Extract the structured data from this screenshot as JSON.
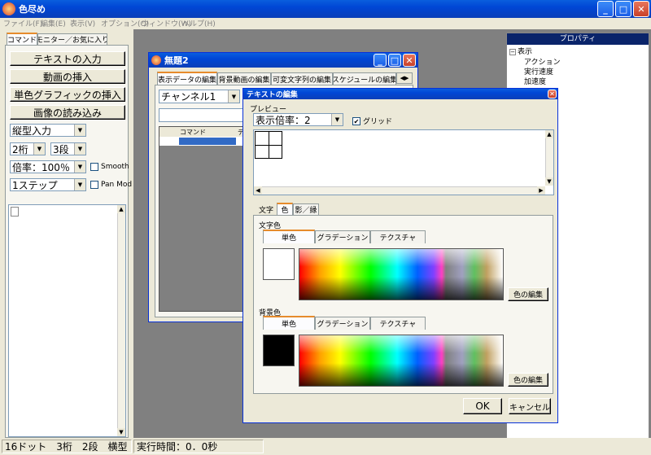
{
  "app": {
    "title": "色尽め"
  },
  "menu": [
    "ファイル(F)",
    "編集(E)",
    "表示(V)",
    "オプション(O)",
    "ウィンドウ(W)",
    "ヘルプ(H)"
  ],
  "left_panel": {
    "tabs": [
      "コマンド",
      "モニター／お気に入り"
    ],
    "buttons": [
      "テキストの入力",
      "動画の挿入",
      "単色グラフィックの挿入",
      "画像の読み込み"
    ],
    "layout_combo": "縦型入力",
    "digits_combo": "2桁",
    "rows_combo": "3段",
    "zoom_combo": "倍率：100％",
    "smooth_label": "Smooth",
    "step_combo": "1ステップ",
    "panmod_label": "Pan Mod"
  },
  "doc_window": {
    "title": "無題2",
    "tabs": [
      "表示データの編集",
      "背景動画の編集",
      "可変文字列の編集",
      "スケジュールの編集"
    ],
    "channel_combo": "チャンネル1",
    "table_headers": [
      "コマンド",
      "デ"
    ]
  },
  "properties": {
    "title": "プロパティ",
    "root": "表示",
    "items": [
      "アクション",
      "実行速度",
      "加速度"
    ]
  },
  "dialog": {
    "title": "テキストの編集",
    "preview_label": "プレビュー",
    "zoom_combo": "表示倍率：2",
    "grid_label": "グリッド",
    "tabs": [
      "文字",
      "色",
      "影／縁"
    ],
    "text_color_label": "文字色",
    "bg_color_label": "背景色",
    "fill_tabs": [
      "単色",
      "グラデーション",
      "テクスチャ"
    ],
    "edit_color_button": "色の編集",
    "ok_button": "OK",
    "cancel_button": "キャンセル",
    "text_color": "#ffffff",
    "bg_color": "#000000"
  },
  "status": {
    "left": "16ドット　3桁　2段　横型",
    "right": "実行時間：0．0秒"
  }
}
